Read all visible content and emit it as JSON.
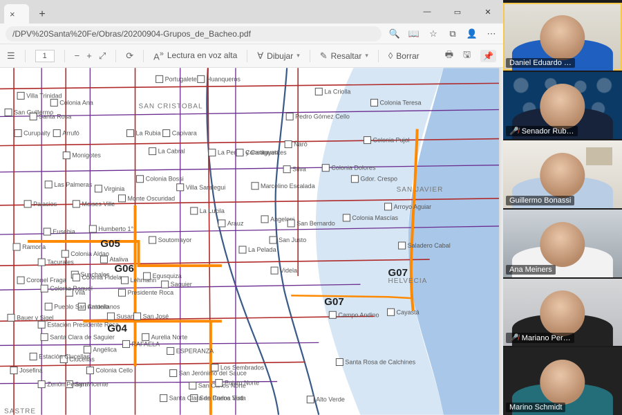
{
  "browser": {
    "url_display": "/DPV%20Santa%20Fe/Obras/20200904-Grupos_de_Bacheo.pdf"
  },
  "pdf_toolbar": {
    "page_current": "1",
    "read_aloud": "Lectura en voz alta",
    "draw": "Dibujar",
    "highlight": "Resaltar",
    "erase": "Borrar"
  },
  "map": {
    "zones": {
      "g04": "G04",
      "g05": "G05",
      "g06": "G06",
      "g07a": "G07",
      "g07b": "G07"
    },
    "departments": {
      "san_cristobal": "SAN CRISTOBAL",
      "san_javier": "SAN JAVIER",
      "helvecia": "HELVECIA",
      "sastre": "SASTRE"
    },
    "cities": {
      "portugalete": "Portugalete",
      "huanqueros": "Huanqueros",
      "la_criolla": "La Criolla",
      "col_teresa": "Colonia Teresa",
      "villa_trinidad": "Villa Trinidad",
      "col_ana": "Colonia Ana",
      "san_guillermo": "San Guillermo",
      "santa_rosa": "Santa Rosa",
      "curupaity": "Curupaity",
      "arrufo": "Arrufó",
      "la_rubia": "La Rubia",
      "capivara": "Capivara",
      "monigotes": "Monigotes",
      "la_cabral": "La Cabral",
      "naro": "Ñaró",
      "las_palmeras": "Las Palmeras",
      "col_bossi": "Colonia Bossi",
      "la_penca": "La Penca y Caraguatá",
      "cons_norte": "Constituyentes",
      "silva": "Silva",
      "palacios": "Palacios",
      "moises_ville": "Moises Ville",
      "monte_oscuro": "Monte Oscuridad",
      "virginia": "Virginia",
      "villa_saralegui": "Villa Saralegui",
      "m_escalada": "Marcelino Escalada",
      "col_dolores": "Colonia Dolores",
      "gdor_crespo": "Gdor. Crespo",
      "la_lucila": "La Lucila",
      "humberto": "Humberto 1°",
      "eusebia": "Eusebia",
      "soutomayor": "Soutomayor",
      "ramona": "Ramona",
      "col_aldao": "Colonia Aldao",
      "ataliva": "Ataliva",
      "tacurales": "Tacurales",
      "sunchales": "Sunchales",
      "lehmann": "Lehmann",
      "pte_roca": "Presidente Roca",
      "egusquiza": "Egusquiza",
      "saguier": "Saguier",
      "vila": "Vila",
      "col_raquel": "Colonia Raquel",
      "bauer_sigel": "Bauer y Sigel",
      "castellanos": "Castellanos",
      "p_san_antonio": "Pueblo San Antonio",
      "est_pres_roca": "Estación Presidente Roca",
      "susana": "Susana",
      "san_jose": "San José",
      "s_clara_sag": "Santa Clara de Saguier",
      "angelica": "Angélica",
      "rafaela": "RAFAELA",
      "clucellas": "Clucellas",
      "est_clucellas": "Estación Clucellas",
      "josefina": "Josefina",
      "col_cello": "Colonia Cello",
      "san_vicente": "San Vicente",
      "zenon_pereyra": "Zenón Pereyra",
      "aurelia": "Aurelia Norte",
      "esperanza": "ESPERANZA",
      "arauz": "Arauz",
      "san_justo": "San Justo",
      "la_pelada": "La Pelada",
      "angeloni": "Angeloni",
      "videla": "Videla",
      "san_bernardo": "San Bernardo",
      "col_mascias": "Colonia Mascías",
      "col_pujol": "Colonia Pujol",
      "sal_cabal": "Saladero Cabal",
      "cayasta": "Cayastá",
      "campo_andino": "Campo Andino",
      "s_rosa_calch": "Santa Rosa de Calchines",
      "san_carlos_n": "San Carlos Norte",
      "san_carlos_s": "San Carlos Sud",
      "s_clara_bv": "Santa Clara de Buena Vista",
      "san_jeronimo": "San Jerónimo del Sauce",
      "pujato_n": "Pujato Norte",
      "los_sembrados": "Los Sembrados",
      "coronel_f": "Coronel Fraga",
      "alto_verde": "Alto Verde",
      "col_fidela": "Colonia Fidela",
      "pedro_gomez": "Pedro Gómez Cello",
      "arroyo_aguiar": "Arroyo Aguiar"
    }
  },
  "participants": [
    {
      "name": "Daniel Eduardo …",
      "muted": false,
      "speaking": true,
      "bg": "bg-room",
      "shirt": "shirt-blue"
    },
    {
      "name": "Senador Rub…",
      "muted": true,
      "speaking": false,
      "bg": "bg-logo",
      "shirt": "shirt-navy"
    },
    {
      "name": "Guillermo Bonassi",
      "muted": false,
      "speaking": false,
      "bg": "bg-office",
      "shirt": "shirt-ltblue"
    },
    {
      "name": "Ana Meiners",
      "muted": false,
      "speaking": false,
      "bg": "bg-hall",
      "shirt": "shirt-white"
    },
    {
      "name": "Mariano Per…",
      "muted": true,
      "speaking": false,
      "bg": "bg-grey",
      "shirt": "shirt-black"
    },
    {
      "name": "Marino Schmidt",
      "muted": false,
      "speaking": false,
      "bg": "bg-dark",
      "shirt": "shirt-teal"
    }
  ]
}
